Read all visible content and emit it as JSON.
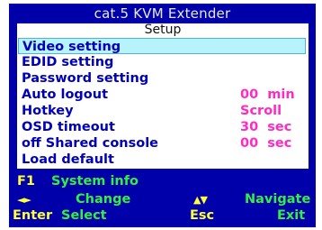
{
  "title": "cat.5 KVM Extender",
  "subtitle": "Setup",
  "menu": {
    "items": [
      {
        "label": "Video setting",
        "value": ""
      },
      {
        "label": "EDID setting",
        "value": ""
      },
      {
        "label": "Password setting",
        "value": ""
      },
      {
        "label": "Auto logout",
        "value": "00  min"
      },
      {
        "label": "Hotkey",
        "value": "Scroll"
      },
      {
        "label": "OSD timeout",
        "value": "30  sec"
      },
      {
        "label": "off Shared console",
        "value": "00  sec"
      },
      {
        "label": "Load default",
        "value": ""
      }
    ],
    "selected_index": 0
  },
  "footer": {
    "f1_key": "F1",
    "f1_action": "System info",
    "lr_arrows": "◄►",
    "lr_action": "Change",
    "ud_arrows": "▲▼",
    "ud_action": "Navigate",
    "enter_key": "Enter",
    "enter_action": "Select",
    "esc_key": "Esc",
    "esc_action": "Exit"
  },
  "colors": {
    "background": "#0000aa",
    "panel": "#ffffff",
    "menu_text": "#0000bb",
    "value_text": "#ff2bc0",
    "selection": "#b6f4f9",
    "key_text": "#ffff3a",
    "action_text": "#33ee44"
  }
}
